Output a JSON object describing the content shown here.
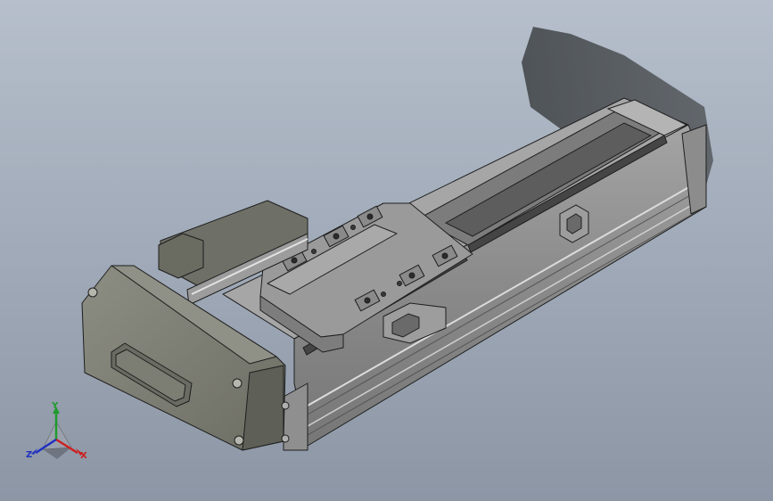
{
  "viewport": {
    "background_top": "#b6bfcb",
    "background_bottom": "#8c96a5"
  },
  "model": {
    "body_color": "#8e8e8e",
    "motor_color": "#7e7f74",
    "edge_color": "#1e1e1e"
  },
  "triad": {
    "x_label": "X",
    "y_label": "Y",
    "z_label": "Z",
    "x_color": "#cc2020",
    "y_color": "#1f9b2e",
    "z_color": "#2030c0"
  }
}
